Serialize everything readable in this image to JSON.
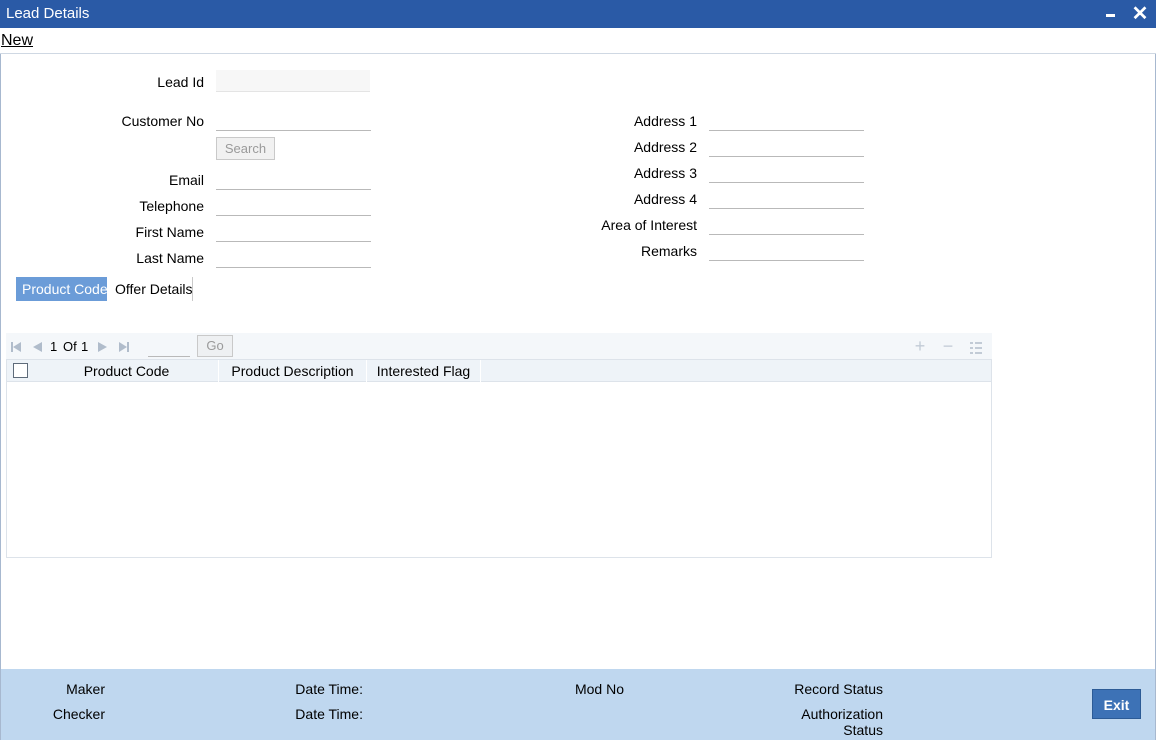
{
  "window": {
    "title": "Lead Details"
  },
  "menu": {
    "new_label": "New"
  },
  "form": {
    "lead_id_label": "Lead Id",
    "customer_no_label": "Customer No",
    "search_label": "Search",
    "email_label": "Email",
    "telephone_label": "Telephone",
    "first_name_label": "First Name",
    "last_name_label": "Last Name",
    "address1_label": "Address 1",
    "address2_label": "Address 2",
    "address3_label": "Address 3",
    "address4_label": "Address 4",
    "area_of_interest_label": "Area of Interest",
    "remarks_label": "Remarks"
  },
  "tabs": [
    {
      "label": "Product Code",
      "active": true
    },
    {
      "label": "Offer Details",
      "active": false
    }
  ],
  "grid": {
    "page_current": "1",
    "page_of": "Of",
    "page_total": "1",
    "go_label": "Go",
    "columns": [
      "Product Code",
      "Product Description",
      "Interested Flag"
    ],
    "rows": []
  },
  "footer": {
    "maker_label": "Maker",
    "checker_label": "Checker",
    "date_time_label_1": "Date Time:",
    "date_time_label_2": "Date Time:",
    "mod_no_label": "Mod No",
    "record_status_label": "Record Status",
    "authorization_label": "Authorization",
    "authorization_status_label": "Status",
    "exit_label": "Exit"
  },
  "colors": {
    "titlebar": "#2a5aa6",
    "active_tab": "#6b9cd8",
    "footer": "#bfd7ef",
    "exit_button": "#3d72b6"
  },
  "icons": [
    "minimize-icon",
    "close-icon",
    "first-page-icon",
    "prev-page-icon",
    "next-page-icon",
    "last-page-icon",
    "add-row-icon",
    "delete-row-icon",
    "columns-icon"
  ]
}
